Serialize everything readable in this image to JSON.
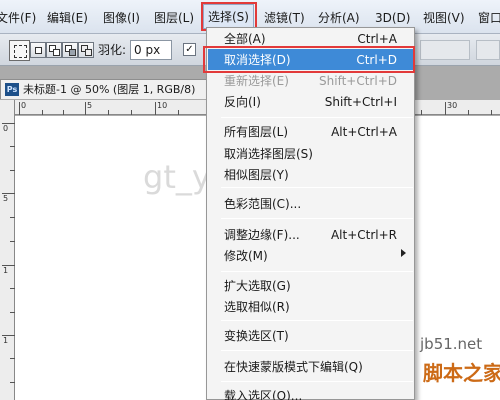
{
  "menubar": {
    "items": [
      "文件(F)",
      "编辑(E)",
      "图像(I)",
      "图层(L)",
      "选择(S)",
      "滤镜(T)",
      "分析(A)",
      "3D(D)",
      "视图(V)",
      "窗口"
    ],
    "active_item": "选择(S)"
  },
  "options_bar": {
    "feather_label": "羽化:",
    "feather_value": "0 px",
    "antialias_checked": "✓"
  },
  "document": {
    "tab_title": "未标题-1 @ 50% (图层 1, RGB/8)",
    "ps_icon": "Ps",
    "ruler_h_labels": [
      "0",
      "5",
      "10",
      "30"
    ],
    "ruler_v_labels": [
      "0",
      "5",
      "1",
      "1"
    ]
  },
  "select_menu": {
    "items": [
      {
        "label": "全部(A)",
        "shortcut": "Ctrl+A",
        "enabled": true
      },
      {
        "label": "取消选择(D)",
        "shortcut": "Ctrl+D",
        "enabled": true,
        "highlighted": true
      },
      {
        "label": "重新选择(E)",
        "shortcut": "Shift+Ctrl+D",
        "enabled": false
      },
      {
        "label": "反向(I)",
        "shortcut": "Shift+Ctrl+I",
        "enabled": true
      },
      {
        "label": "所有图层(L)",
        "shortcut": "Alt+Ctrl+A",
        "enabled": true
      },
      {
        "label": "取消选择图层(S)",
        "shortcut": "",
        "enabled": true
      },
      {
        "label": "相似图层(Y)",
        "shortcut": "",
        "enabled": true
      },
      {
        "label": "色彩范围(C)...",
        "shortcut": "",
        "enabled": true
      },
      {
        "label": "调整边缘(F)...",
        "shortcut": "Alt+Ctrl+R",
        "enabled": true
      },
      {
        "label": "修改(M)",
        "shortcut": "",
        "enabled": true,
        "submenu": true
      },
      {
        "label": "扩大选取(G)",
        "shortcut": "",
        "enabled": true
      },
      {
        "label": "选取相似(R)",
        "shortcut": "",
        "enabled": true
      },
      {
        "label": "变换选区(T)",
        "shortcut": "",
        "enabled": true
      },
      {
        "label": "在快速蒙版模式下编辑(Q)",
        "shortcut": "",
        "enabled": true
      },
      {
        "label": "载入选区(O)...",
        "shortcut": "",
        "enabled": true
      }
    ]
  },
  "watermarks": {
    "center": "gt_yanzi",
    "site": "jb51.net",
    "brand": "脚本之家"
  },
  "colors": {
    "highlight_blue": "#3e8ad7",
    "annotation_red": "#e23a3a"
  }
}
